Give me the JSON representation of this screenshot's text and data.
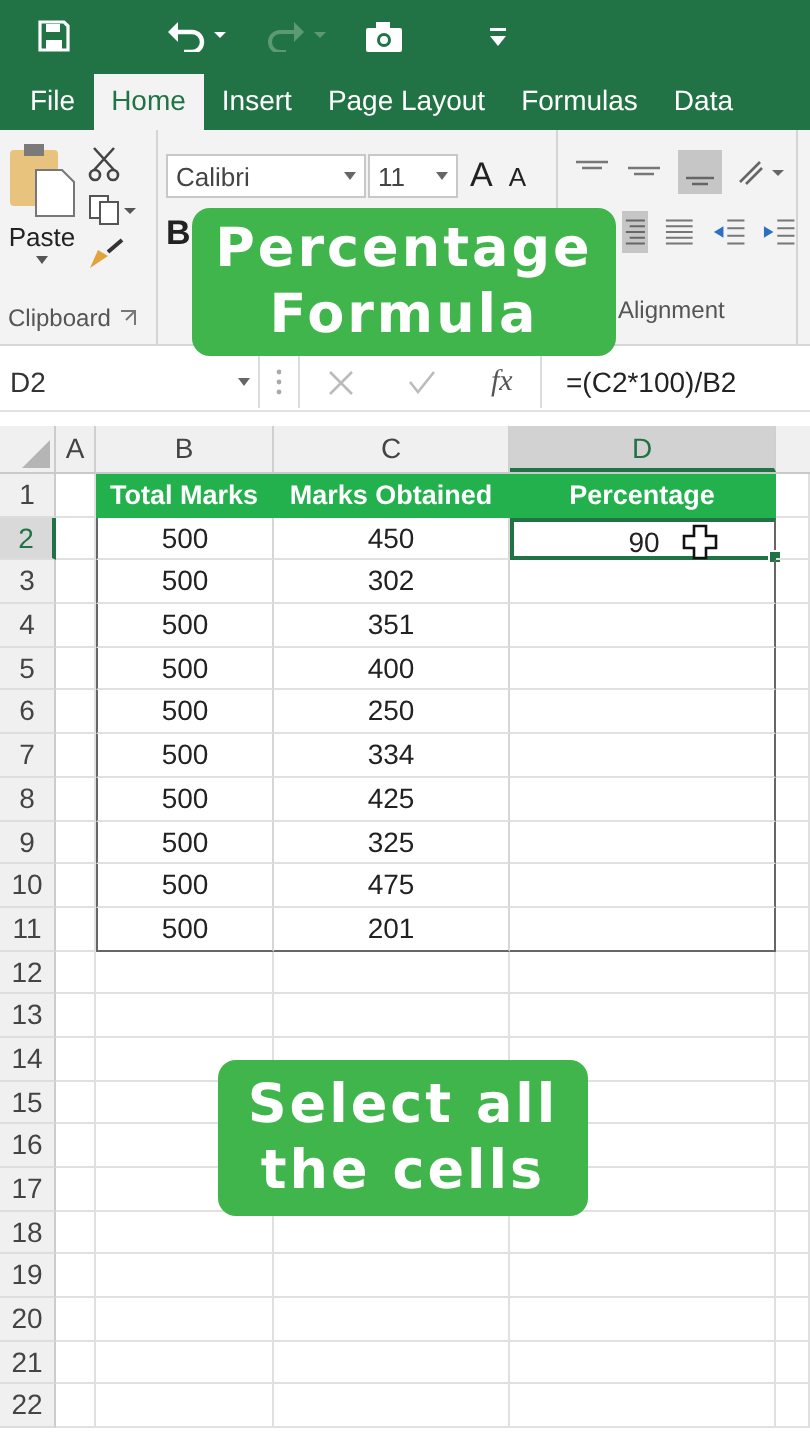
{
  "tabs": [
    {
      "label": "File",
      "selected": false
    },
    {
      "label": "Home",
      "selected": true
    },
    {
      "label": "Insert",
      "selected": false
    },
    {
      "label": "Page Layout",
      "selected": false
    },
    {
      "label": "Formulas",
      "selected": false
    },
    {
      "label": "Data",
      "selected": false
    }
  ],
  "ribbon": {
    "paste_label": "Paste",
    "bold_label": "B",
    "font_name": "Calibri",
    "font_size": "11",
    "grow_label": "A",
    "shrink_label": "A",
    "clipboard_label": "Clipboard",
    "alignment_label": "Alignment"
  },
  "formula_bar": {
    "cell": "D2",
    "fx": "fx",
    "formula": "=(C2*100)/B2"
  },
  "columns": [
    {
      "label": "A",
      "selected": false
    },
    {
      "label": "B",
      "selected": false
    },
    {
      "label": "C",
      "selected": false
    },
    {
      "label": "D",
      "selected": true
    }
  ],
  "rows": [
    {
      "number": "1",
      "kind": "header",
      "selected": false,
      "cells": [
        "Total Marks",
        "Marks Obtained",
        "Percentage"
      ]
    },
    {
      "number": "2",
      "kind": "data",
      "selected": true,
      "cells": [
        "500",
        "450",
        "90"
      ]
    },
    {
      "number": "3",
      "kind": "data",
      "selected": false,
      "cells": [
        "500",
        "302"
      ]
    },
    {
      "number": "4",
      "kind": "data",
      "selected": false,
      "cells": [
        "500",
        "351"
      ]
    },
    {
      "number": "5",
      "kind": "data",
      "selected": false,
      "cells": [
        "500",
        "400"
      ]
    },
    {
      "number": "6",
      "kind": "data",
      "selected": false,
      "cells": [
        "500",
        "250"
      ]
    },
    {
      "number": "7",
      "kind": "data",
      "selected": false,
      "cells": [
        "500",
        "334"
      ]
    },
    {
      "number": "8",
      "kind": "data",
      "selected": false,
      "cells": [
        "500",
        "425"
      ]
    },
    {
      "number": "9",
      "kind": "data",
      "selected": false,
      "cells": [
        "500",
        "325"
      ]
    },
    {
      "number": "10",
      "kind": "data",
      "selected": false,
      "cells": [
        "500",
        "475"
      ]
    },
    {
      "number": "11",
      "kind": "data",
      "selected": false,
      "cells": [
        "500",
        "201"
      ]
    },
    {
      "number": "12",
      "kind": "empty",
      "selected": false
    },
    {
      "number": "13",
      "kind": "empty",
      "selected": false
    },
    {
      "number": "14",
      "kind": "empty",
      "selected": false
    },
    {
      "number": "15",
      "kind": "empty",
      "selected": false
    },
    {
      "number": "16",
      "kind": "empty",
      "selected": false
    },
    {
      "number": "17",
      "kind": "empty",
      "selected": false
    },
    {
      "number": "18",
      "kind": "empty",
      "selected": false
    },
    {
      "number": "19",
      "kind": "empty",
      "selected": false
    },
    {
      "number": "20",
      "kind": "empty",
      "selected": false
    },
    {
      "number": "21",
      "kind": "empty",
      "selected": false
    },
    {
      "number": "22",
      "kind": "empty",
      "selected": false
    }
  ],
  "captions": [
    {
      "lines": [
        "Percentage",
        "Formula"
      ]
    },
    {
      "lines": [
        "Select all",
        "the cells"
      ]
    }
  ]
}
